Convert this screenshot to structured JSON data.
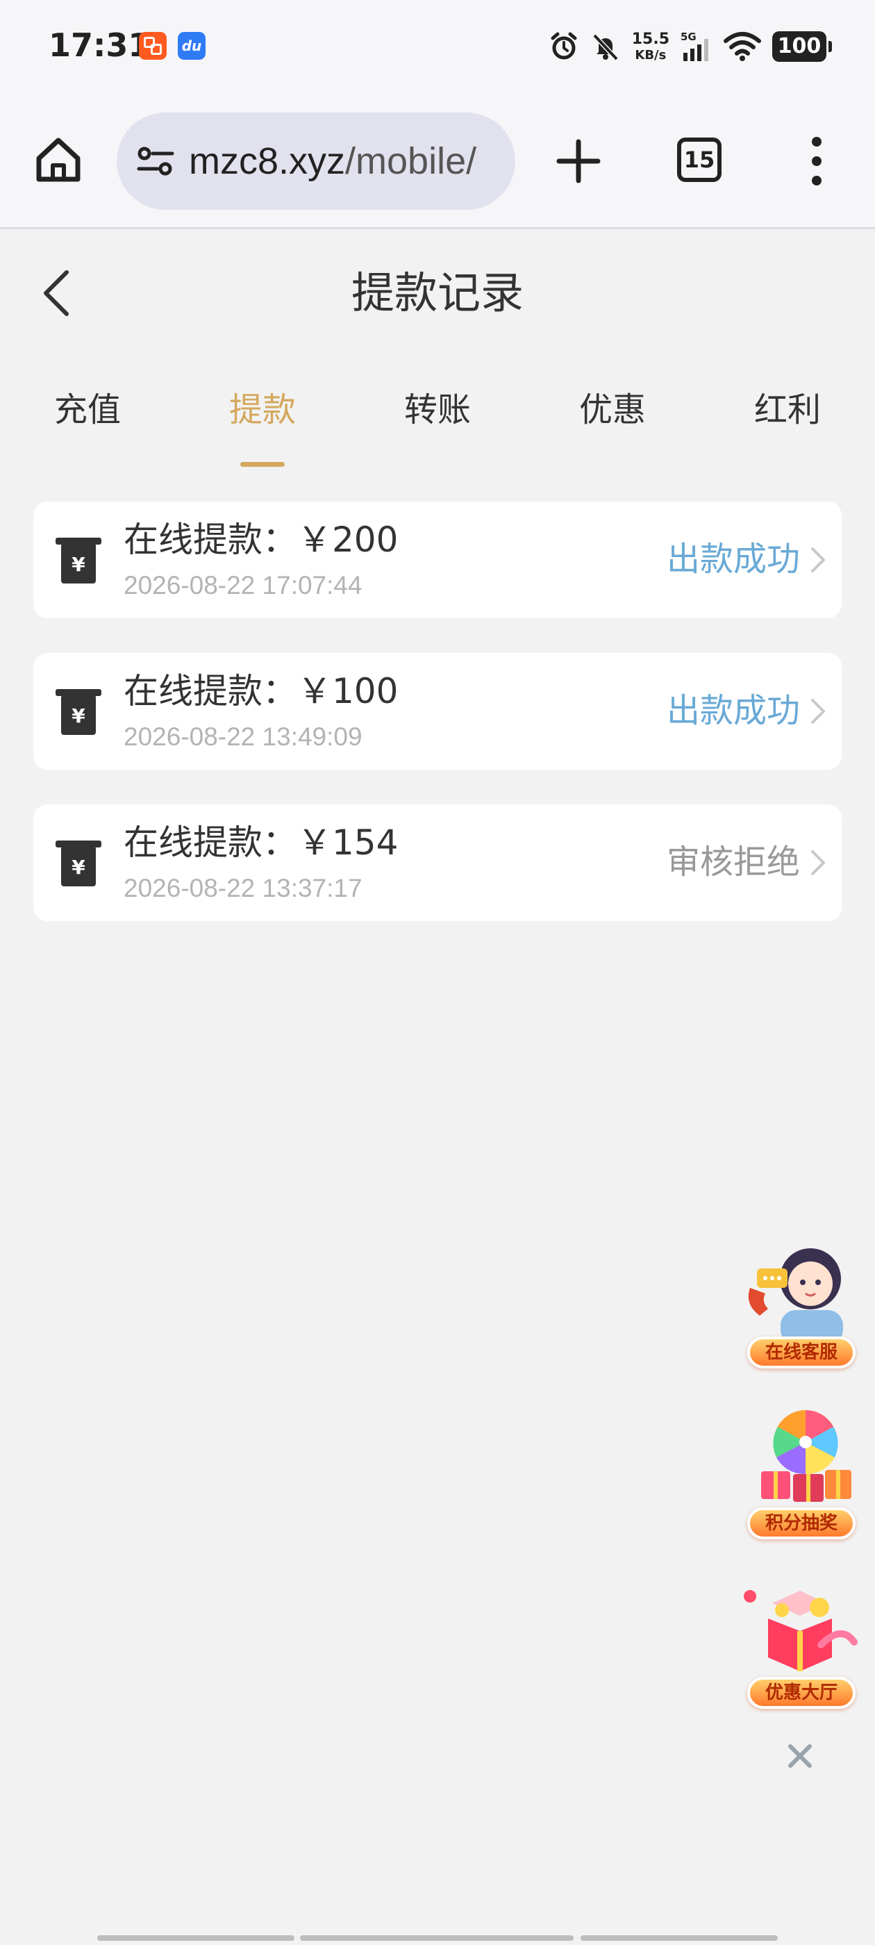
{
  "status_bar": {
    "time": "17:31",
    "network_speed_value": "15.5",
    "network_speed_unit": "KB/s",
    "network_type": "5G",
    "battery": "100",
    "icons": [
      "alarm-icon",
      "bell-muted-icon",
      "signal-icon",
      "wifi-icon"
    ]
  },
  "browser": {
    "url_host": "mzc8.xyz",
    "url_path": "/mobile/",
    "tab_count": "15"
  },
  "page": {
    "title": "提款记录"
  },
  "tabs": [
    {
      "label": "充值",
      "active": false
    },
    {
      "label": "提款",
      "active": true
    },
    {
      "label": "转账",
      "active": false
    },
    {
      "label": "优惠",
      "active": false
    },
    {
      "label": "红利",
      "active": false
    }
  ],
  "records": [
    {
      "title": "在线提款：￥200",
      "time": "2026-08-22 17:07:44",
      "status": "出款成功",
      "status_type": "success"
    },
    {
      "title": "在线提款：￥100",
      "time": "2026-08-22 13:49:09",
      "status": "出款成功",
      "status_type": "success"
    },
    {
      "title": "在线提款：￥154",
      "time": "2026-08-22 13:37:17",
      "status": "审核拒绝",
      "status_type": "rejected"
    }
  ],
  "floating": [
    {
      "label": "在线客服"
    },
    {
      "label": "积分抽奖"
    },
    {
      "label": "优惠大厅"
    }
  ],
  "colors": {
    "accent": "#d4a85e",
    "success": "#69a9d6",
    "rejected": "#999999",
    "background": "#f2f2f2"
  }
}
